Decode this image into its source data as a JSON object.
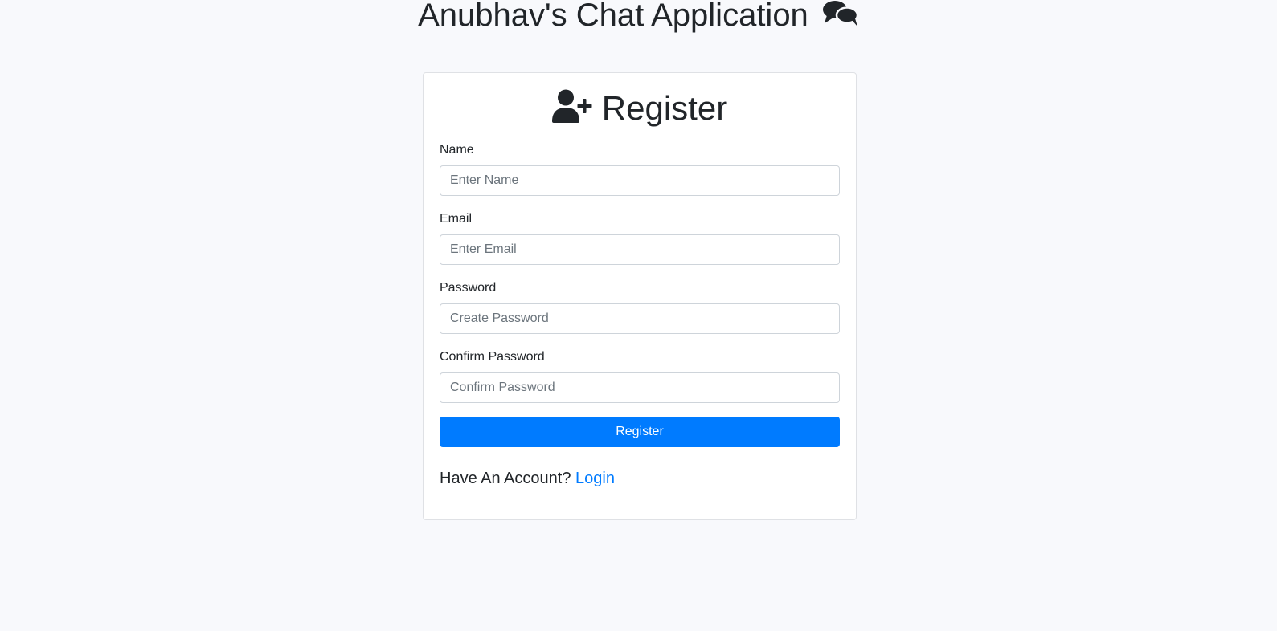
{
  "header": {
    "title": "Anubhav's Chat Application",
    "icon": "comments-icon"
  },
  "card": {
    "title": "Register",
    "icon": "user-plus-icon",
    "fields": {
      "name": {
        "label": "Name",
        "placeholder": "Enter Name",
        "value": ""
      },
      "email": {
        "label": "Email",
        "placeholder": "Enter Email",
        "value": ""
      },
      "password": {
        "label": "Password",
        "placeholder": "Create Password",
        "value": ""
      },
      "confirm_password": {
        "label": "Confirm Password",
        "placeholder": "Confirm Password",
        "value": ""
      }
    },
    "submit_label": "Register",
    "account_prompt": "Have An Account?",
    "login_link": "Login"
  },
  "colors": {
    "primary": "#007bff",
    "background": "#f8f9fc",
    "text": "#212529"
  }
}
